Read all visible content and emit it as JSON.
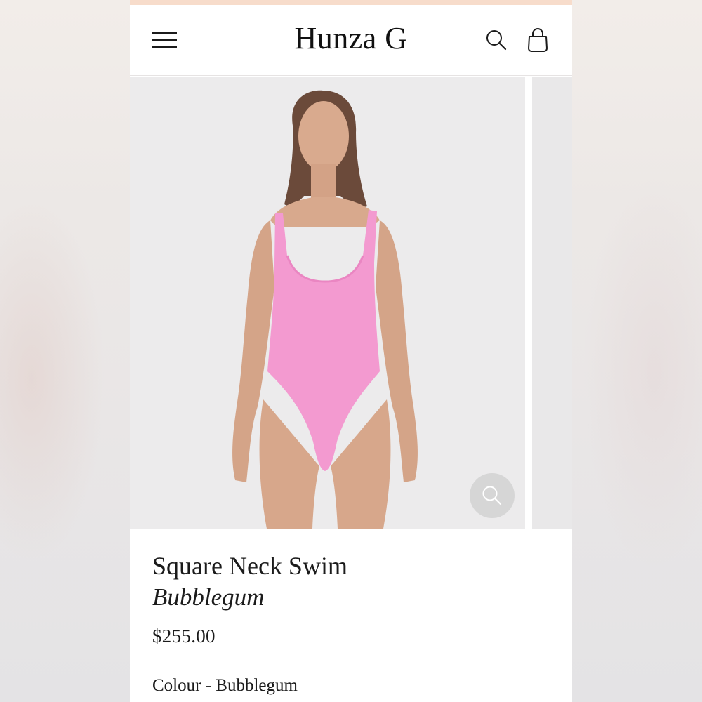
{
  "brand": {
    "logo_text": "Hunza G"
  },
  "header": {
    "menu_icon": "hamburger-menu-icon",
    "search_icon": "search-icon",
    "bag_icon": "shopping-bag-icon"
  },
  "gallery": {
    "image_alt": "Model wearing pink square neck one-piece swimsuit",
    "zoom_icon": "magnifier-icon"
  },
  "product": {
    "title": "Square Neck Swim",
    "colorway": "Bubblegum",
    "price": "$255.00",
    "colour_label": "Colour",
    "colour_separator": " - ",
    "colour_value": "Bubblegum"
  },
  "colors": {
    "announce_bar": "#f7dccb",
    "swimsuit": "#f39ad0",
    "image_bg": "#ecebec"
  }
}
